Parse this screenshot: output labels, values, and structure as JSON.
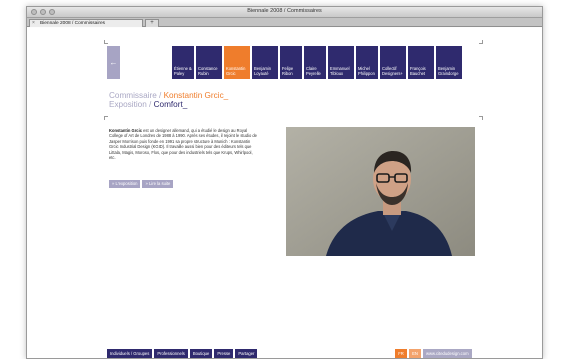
{
  "window": {
    "title": "Biennale 2008 / Commissaires"
  },
  "tab": {
    "label": "Biennale 2008 / Commissaires",
    "close": "×",
    "new_tab": "+"
  },
  "nav": {
    "back": "←",
    "items": [
      {
        "label": "Étienne & Paley"
      },
      {
        "label": "Constance Rubin"
      },
      {
        "label": "Konstantin Grcic"
      },
      {
        "label": "Benjamin Loyauté"
      },
      {
        "label": "Felipe Ribon"
      },
      {
        "label": "Claire Peyrelle"
      },
      {
        "label": "Emmanuel Tibloux"
      },
      {
        "label": "Michel Philippon"
      },
      {
        "label": "Collectif Designers+"
      },
      {
        "label": "François Bauchet"
      },
      {
        "label": "Benjamin Graindorge"
      }
    ]
  },
  "heading": {
    "prefix": "Commissaire / ",
    "name": "Konstantin Grcic_",
    "expo_prefix": "Exposition / ",
    "expo_name": "Comfort_"
  },
  "body": {
    "name_bold": "Konstantin Grcic",
    "text": " est un designer allemand, qui a étudié le design au Royal College of Art de Londres de 1988 à 1990. Après ses études, il rejoint le studio de Jasper Morrison puis fonde en 1991 sa propre structure à Munich : Konstantin Grcic Industrial Design (KGID). Il travaille aussi bien pour des éditeurs tels que Littala, Magis, Moroso, Flos, que pour des industriels tels que Krups, Whirlpool, etc."
  },
  "buttons": {
    "exposition": "» L'exposition",
    "lire_plus": "» Lire la suite"
  },
  "footer": {
    "items": [
      {
        "label": "Individuels / Groupes"
      },
      {
        "label": "Professionnels"
      },
      {
        "label": "Boutique"
      },
      {
        "label": "Presse"
      },
      {
        "label": "Partager"
      }
    ],
    "lang_fr": "FR",
    "lang_en": "EN",
    "site": "www.citedudesign.com"
  }
}
